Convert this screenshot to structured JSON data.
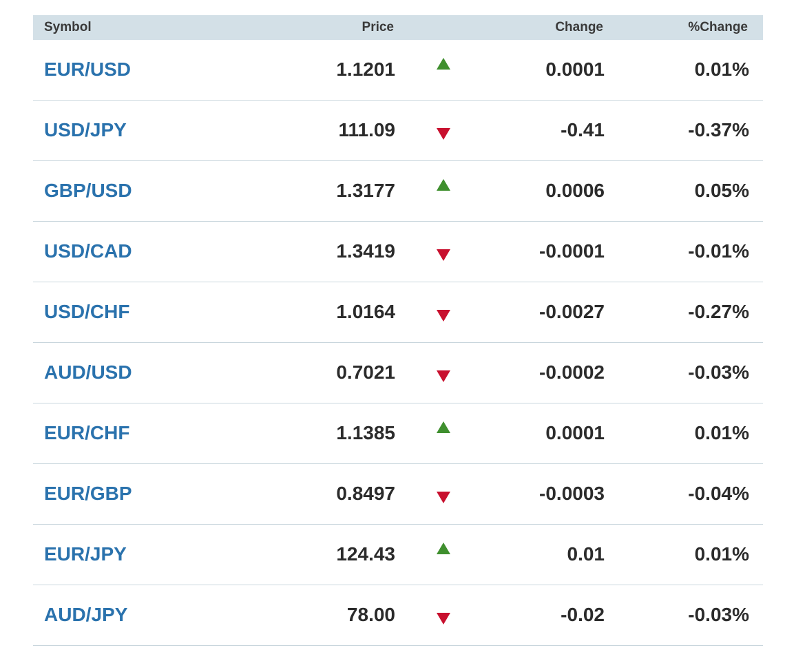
{
  "header": {
    "symbol": "Symbol",
    "price": "Price",
    "change": "Change",
    "pct_change": "%Change"
  },
  "colors": {
    "header_bg": "#d3e0e7",
    "symbol_link": "#2a72ad",
    "up": "#3f8f2e",
    "down": "#c8102e"
  },
  "rows": [
    {
      "symbol": "EUR/USD",
      "price": "1.1201",
      "direction": "up",
      "direction_icon": "up-triangle-icon",
      "change": "0.0001",
      "pct": "0.01%"
    },
    {
      "symbol": "USD/JPY",
      "price": "111.09",
      "direction": "down",
      "direction_icon": "down-triangle-icon",
      "change": "-0.41",
      "pct": "-0.37%"
    },
    {
      "symbol": "GBP/USD",
      "price": "1.3177",
      "direction": "up",
      "direction_icon": "up-triangle-icon",
      "change": "0.0006",
      "pct": "0.05%"
    },
    {
      "symbol": "USD/CAD",
      "price": "1.3419",
      "direction": "down",
      "direction_icon": "down-triangle-icon",
      "change": "-0.0001",
      "pct": "-0.01%"
    },
    {
      "symbol": "USD/CHF",
      "price": "1.0164",
      "direction": "down",
      "direction_icon": "down-triangle-icon",
      "change": "-0.0027",
      "pct": "-0.27%"
    },
    {
      "symbol": "AUD/USD",
      "price": "0.7021",
      "direction": "down",
      "direction_icon": "down-triangle-icon",
      "change": "-0.0002",
      "pct": "-0.03%"
    },
    {
      "symbol": "EUR/CHF",
      "price": "1.1385",
      "direction": "up",
      "direction_icon": "up-triangle-icon",
      "change": "0.0001",
      "pct": "0.01%"
    },
    {
      "symbol": "EUR/GBP",
      "price": "0.8497",
      "direction": "down",
      "direction_icon": "down-triangle-icon",
      "change": "-0.0003",
      "pct": "-0.04%"
    },
    {
      "symbol": "EUR/JPY",
      "price": "124.43",
      "direction": "up",
      "direction_icon": "up-triangle-icon",
      "change": "0.01",
      "pct": "0.01%"
    },
    {
      "symbol": "AUD/JPY",
      "price": "78.00",
      "direction": "down",
      "direction_icon": "down-triangle-icon",
      "change": "-0.02",
      "pct": "-0.03%"
    }
  ]
}
